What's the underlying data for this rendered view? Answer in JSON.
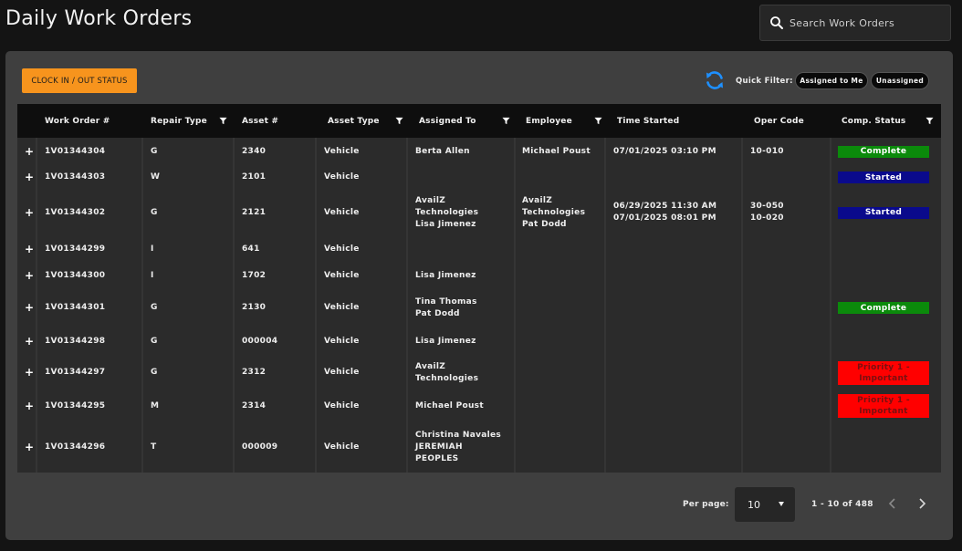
{
  "page": {
    "title": "Daily Work Orders"
  },
  "search": {
    "placeholder": "Search Work Orders"
  },
  "toolbar": {
    "clock_label": "CLOCK IN / OUT STATUS",
    "quick_filter_label": "Quick Filter:",
    "filters": [
      "Assigned to Me",
      "Unassigned"
    ]
  },
  "colors": {
    "accent": "#f7941d",
    "refresh": "#1e90ff",
    "complete": "#0b8a0b",
    "started": "#0a0a8c",
    "priority": "#ff0000"
  },
  "table": {
    "headers": [
      "Work Order #",
      "Repair Type",
      "Asset #",
      "Asset Type",
      "Assigned To",
      "Employee",
      "Time Started",
      "Oper Code",
      "Comp. Status"
    ],
    "rows": [
      {
        "wo": "1V01344304",
        "repair": "G",
        "asset": "2340",
        "type": "Vehicle",
        "assigned": [
          "Berta Allen"
        ],
        "employee": [
          "Michael Poust"
        ],
        "time": [
          "07/01/2025 03:10 PM"
        ],
        "oper": [
          "10-010"
        ],
        "status": {
          "label": [
            "Complete"
          ],
          "kind": "complete"
        }
      },
      {
        "wo": "1V01344303",
        "repair": "W",
        "asset": "2101",
        "type": "Vehicle",
        "assigned": [],
        "employee": [],
        "time": [],
        "oper": [],
        "status": {
          "label": [
            "Started"
          ],
          "kind": "started"
        }
      },
      {
        "wo": "1V01344302",
        "repair": "G",
        "asset": "2121",
        "type": "Vehicle",
        "assigned": [
          "AvailZ",
          "Technologies",
          "Lisa Jimenez"
        ],
        "employee": [
          "AvailZ",
          "Technologies",
          "Pat Dodd"
        ],
        "time": [
          "06/29/2025 11:30 AM",
          "07/01/2025 08:01 PM"
        ],
        "oper": [
          "30-050",
          "10-020"
        ],
        "status": {
          "label": [
            "Started"
          ],
          "kind": "started"
        }
      },
      {
        "wo": "1V01344299",
        "repair": "I",
        "asset": "641",
        "type": "Vehicle",
        "assigned": [],
        "employee": [],
        "time": [],
        "oper": [],
        "status": null
      },
      {
        "wo": "1V01344300",
        "repair": "I",
        "asset": "1702",
        "type": "Vehicle",
        "assigned": [
          "Lisa Jimenez"
        ],
        "employee": [],
        "time": [],
        "oper": [],
        "status": null
      },
      {
        "wo": "1V01344301",
        "repair": "G",
        "asset": "2130",
        "type": "Vehicle",
        "assigned": [
          "Tina Thomas",
          "Pat Dodd"
        ],
        "employee": [],
        "time": [],
        "oper": [],
        "status": {
          "label": [
            "Complete"
          ],
          "kind": "complete"
        }
      },
      {
        "wo": "1V01344298",
        "repair": "G",
        "asset": "000004",
        "type": "Vehicle",
        "assigned": [
          "Lisa Jimenez"
        ],
        "employee": [],
        "time": [],
        "oper": [],
        "status": null
      },
      {
        "wo": "1V01344297",
        "repair": "G",
        "asset": "2312",
        "type": "Vehicle",
        "assigned": [
          "AvailZ",
          "Technologies"
        ],
        "employee": [],
        "time": [],
        "oper": [],
        "status": {
          "label": [
            "Priority 1 -",
            "Important"
          ],
          "kind": "priority"
        }
      },
      {
        "wo": "1V01344295",
        "repair": "M",
        "asset": "2314",
        "type": "Vehicle",
        "assigned": [
          "Michael Poust"
        ],
        "employee": [],
        "time": [],
        "oper": [],
        "status": {
          "label": [
            "Priority 1 -",
            "Important"
          ],
          "kind": "priority"
        }
      },
      {
        "wo": "1V01344296",
        "repair": "T",
        "asset": "000009",
        "type": "Vehicle",
        "assigned": [
          "Christina Navales",
          "JEREMIAH",
          "PEOPLES"
        ],
        "employee": [],
        "time": [],
        "oper": [],
        "status": null
      }
    ]
  },
  "pagination": {
    "per_page_label": "Per page:",
    "per_page_value": "10",
    "range": "1 - 10 of 488"
  }
}
